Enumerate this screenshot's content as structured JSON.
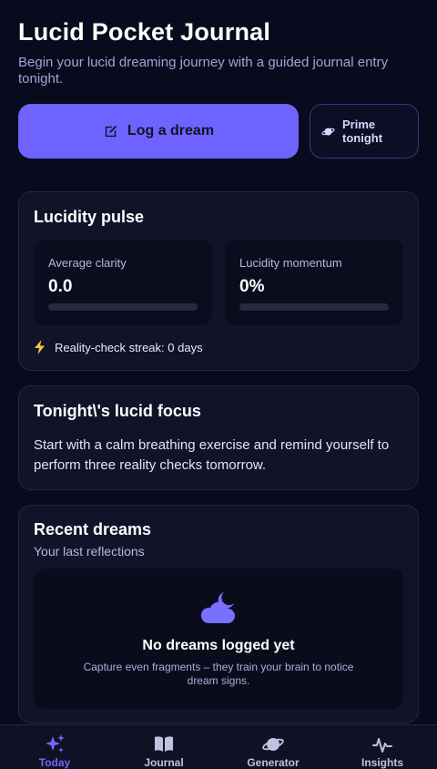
{
  "header": {
    "title": "Lucid Pocket Journal",
    "subtitle": "Begin your lucid dreaming journey with a guided journal entry tonight."
  },
  "actions": {
    "log_label": "Log a dream",
    "prime_label": "Prime tonight"
  },
  "pulse": {
    "title": "Lucidity pulse",
    "clarity_label": "Average clarity",
    "clarity_value": "0.0",
    "clarity_fraction": 0,
    "momentum_label": "Lucidity momentum",
    "momentum_value": "0%",
    "momentum_fraction": 0,
    "streak_text": "Reality-check streak: 0 days"
  },
  "focus": {
    "title": "Tonight\\'s lucid focus",
    "text": "Start with a calm breathing exercise and remind yourself to perform three reality checks tomorrow."
  },
  "recent": {
    "title": "Recent dreams",
    "subtitle": "Your last reflections",
    "empty_title": "No dreams logged yet",
    "empty_text": "Capture even fragments – they train your brain to notice dream signs."
  },
  "nav": [
    {
      "label": "Today",
      "icon": "sparkles-icon",
      "active": true
    },
    {
      "label": "Journal",
      "icon": "book-icon",
      "active": false
    },
    {
      "label": "Generator",
      "icon": "planet-icon",
      "active": false
    },
    {
      "label": "Insights",
      "icon": "pulse-icon",
      "active": false
    }
  ],
  "colors": {
    "background": "#080b1d",
    "accent": "#6e63ff",
    "card": "#111329",
    "streak_bolt": "#f5c542"
  }
}
